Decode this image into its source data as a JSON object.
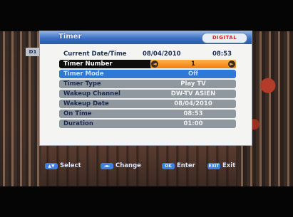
{
  "dialog": {
    "title": "Timer",
    "logo": "DIGITAL",
    "left_tab": "D1"
  },
  "rows": {
    "current_datetime": {
      "label": "Current Date/Time",
      "date": "08/04/2010",
      "time": "08:53"
    },
    "timer_number": {
      "label": "Timer Number",
      "value": "1"
    },
    "timer_mode": {
      "label": "Timer Mode",
      "value": "Off"
    },
    "timer_type": {
      "label": "Timer Type",
      "value": "Play TV"
    },
    "wakeup_channel": {
      "label": "Wakeup Channel",
      "value": "DW-TV ASIEN"
    },
    "wakeup_date": {
      "label": "Wakeup Date",
      "value": "08/04/2010"
    },
    "on_time": {
      "label": "On Time",
      "value": "08:53"
    },
    "duration": {
      "label": "Duration",
      "value": "01:00"
    }
  },
  "footer": {
    "select": {
      "key": "▲▼",
      "label": "Select"
    },
    "change": {
      "key": "◄►",
      "label": "Change"
    },
    "enter": {
      "key": "OK",
      "label": "Enter"
    },
    "exit": {
      "key": "EXIT",
      "label": "Exit"
    }
  },
  "colors": {
    "header_blue": "#3d6fc4",
    "selected_value": "#ef7d12",
    "highlight_row": "#2e79d6",
    "row_gray": "#8f979f"
  }
}
